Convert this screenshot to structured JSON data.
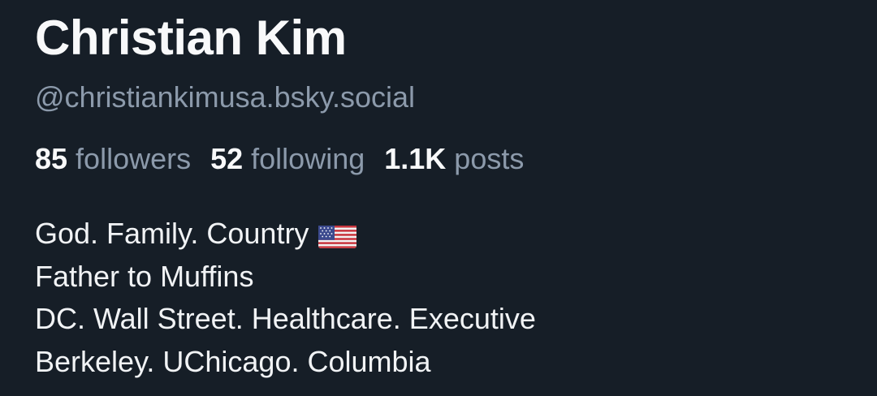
{
  "profile": {
    "display_name": "Christian Kim",
    "handle": "@christiankimusa.bsky.social",
    "stats": {
      "followers_count": "85",
      "followers_label": "followers",
      "following_count": "52",
      "following_label": "following",
      "posts_count": "1.1K",
      "posts_label": "posts"
    },
    "bio": {
      "line1": "God. Family. Country",
      "line1_icon": "us-flag-icon",
      "line2": "Father to Muffins",
      "line3": "DC. Wall Street. Healthcare. Executive",
      "line4": "Berkeley. UChicago. Columbia"
    }
  },
  "colors": {
    "background": "#161e27",
    "primary_text": "#f8f9fa",
    "secondary_text": "#8c9aab"
  }
}
